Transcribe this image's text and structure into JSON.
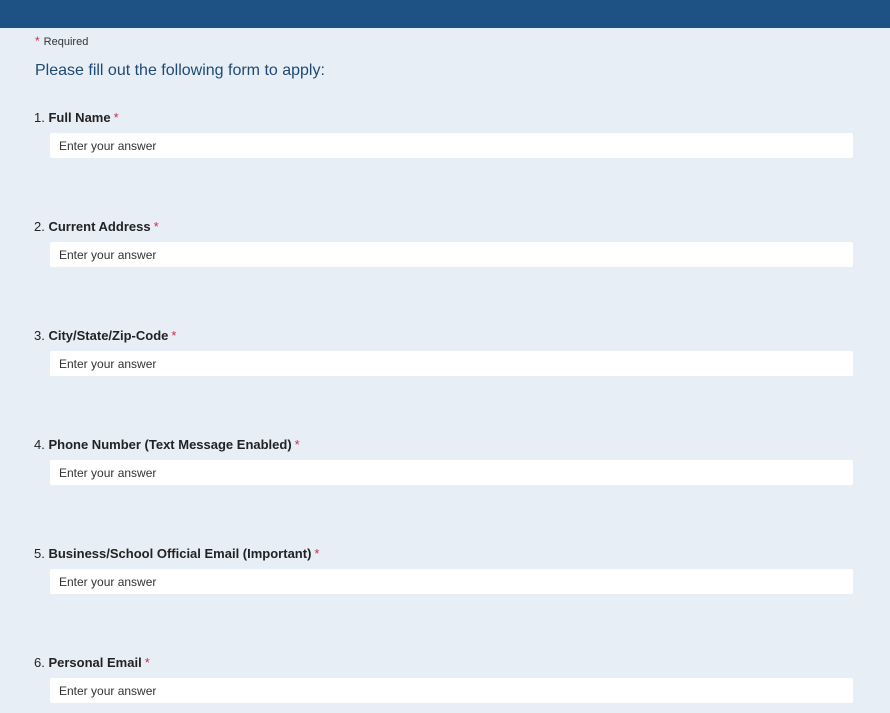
{
  "header": {
    "required_star": "*",
    "required_label": "Required",
    "intro": "Please fill out the following form to apply:"
  },
  "questions": [
    {
      "num": "1.",
      "label": "Full Name",
      "star": "*",
      "placeholder": "Enter your answer",
      "value": ""
    },
    {
      "num": "2.",
      "label": "Current Address",
      "star": "*",
      "placeholder": "Enter your answer",
      "value": ""
    },
    {
      "num": "3.",
      "label": "City/State/Zip-Code",
      "star": "*",
      "placeholder": "Enter your answer",
      "value": ""
    },
    {
      "num": "4.",
      "label": "Phone Number (Text Message Enabled)",
      "star": "*",
      "placeholder": "Enter your answer",
      "value": ""
    },
    {
      "num": "5.",
      "label": "Business/School Official Email (Important)",
      "star": "*",
      "placeholder": "Enter your answer",
      "value": ""
    },
    {
      "num": "6.",
      "label": "Personal Email",
      "star": "*",
      "placeholder": "Enter your answer",
      "value": ""
    }
  ],
  "colors": {
    "top_bar": "#1e5284",
    "background": "#e8eef5",
    "required_star": "#c4314b",
    "intro_text": "#1e4a72"
  }
}
